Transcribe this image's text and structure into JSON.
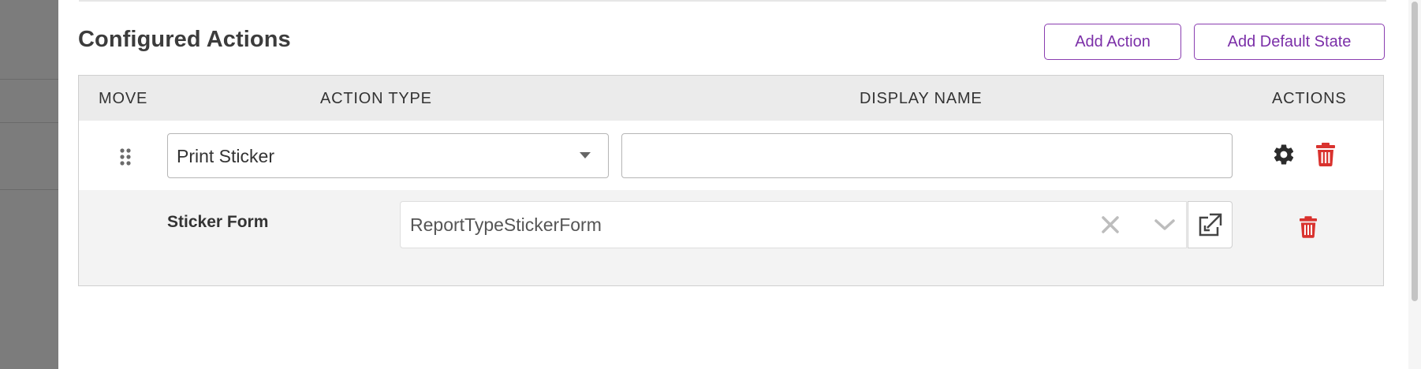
{
  "section": {
    "title": "Configured Actions"
  },
  "buttons": {
    "add_action": "Add Action",
    "add_default_state": "Add Default State"
  },
  "table": {
    "headers": {
      "move": "MOVE",
      "action_type": "ACTION TYPE",
      "display_name": "DISPLAY NAME",
      "actions": "ACTIONS"
    },
    "rows": [
      {
        "action_type": "Print Sticker",
        "display_name": "",
        "sub_settings": [
          {
            "label": "Sticker Form",
            "value": "ReportTypeStickerForm"
          }
        ]
      }
    ]
  },
  "icons": {
    "drag": "drag-handle-icon",
    "settings": "gear-icon",
    "delete": "trash-icon",
    "clear": "clear-x-icon",
    "expand": "chevron-down-icon",
    "open": "open-external-icon"
  },
  "colors": {
    "accent": "#7b2fa8",
    "danger": "#d9322e",
    "header_bg": "#ebebeb"
  }
}
